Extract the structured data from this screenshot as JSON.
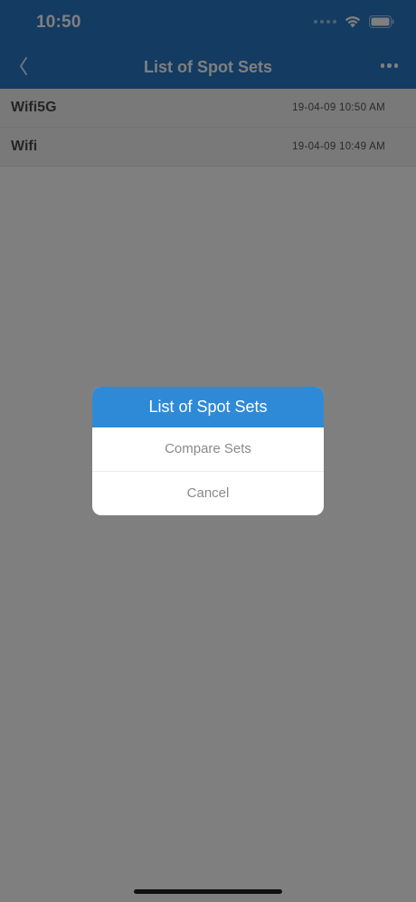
{
  "status_bar": {
    "time": "10:50",
    "icons": [
      "signal-dots-icon",
      "wifi-icon",
      "battery-icon"
    ]
  },
  "nav": {
    "title": "List of Spot Sets",
    "back_icon": "chevron-left-icon",
    "more_icon": "more-dots-icon"
  },
  "list": {
    "items": [
      {
        "name": "Wifi5G",
        "date": "19-04-09 10:50 AM"
      },
      {
        "name": "Wifi",
        "date": "19-04-09 10:49 AM"
      }
    ]
  },
  "dialog": {
    "title": "List of Spot Sets",
    "options": [
      {
        "label": "Compare Sets"
      },
      {
        "label": "Cancel"
      }
    ]
  },
  "colors": {
    "header": "#2877c4",
    "dialog_header": "#2e8ad6",
    "overlay": "rgba(0,0,0,0.5)"
  }
}
